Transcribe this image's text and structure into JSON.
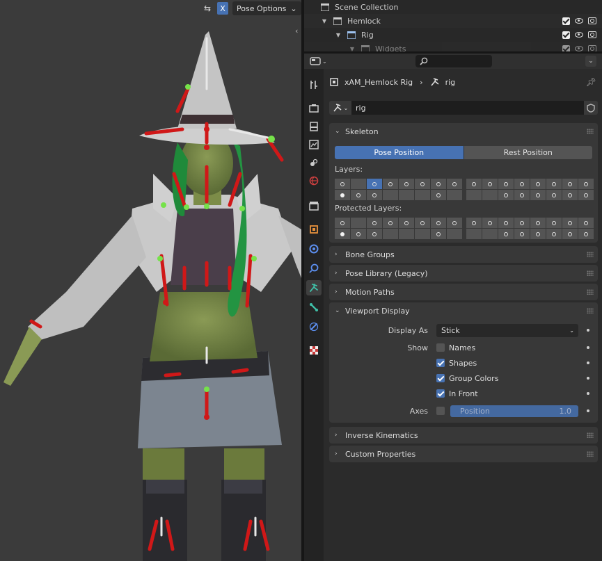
{
  "viewport": {
    "x_axis_label": "X",
    "pose_options_label": "Pose Options"
  },
  "outliner": {
    "rows": [
      {
        "label": "Scene Collection"
      },
      {
        "label": "Hemlock"
      },
      {
        "label": "Rig"
      },
      {
        "label": "Widgets"
      }
    ]
  },
  "properties": {
    "search_placeholder": "",
    "breadcrumb": {
      "object": "xAM_Hemlock Rig",
      "data": "rig"
    },
    "datablock_name": "rig",
    "tabs": [
      "tool",
      "render",
      "output",
      "view-layer",
      "scene",
      "world",
      "collection",
      "object",
      "modifiers",
      "particles",
      "physics",
      "object-data-armature",
      "bone",
      "bone-constraints",
      "texture"
    ],
    "active_tab": "object-data-armature",
    "skeleton": {
      "title": "Skeleton",
      "pose_position": "Pose Position",
      "rest_position": "Rest Position",
      "active_position": "Pose Position",
      "layers_label": "Layers:",
      "protected_layers_label": "Protected Layers:",
      "layers": {
        "left": [
          [
            "o",
            "",
            "sel",
            "o",
            "o",
            "o",
            "o",
            "o"
          ],
          [
            "full",
            "o",
            "o",
            "",
            "",
            "",
            "o",
            ""
          ]
        ],
        "right": [
          [
            "o",
            "o",
            "o",
            "o",
            "o",
            "o",
            "o",
            "o"
          ],
          [
            "",
            "",
            "o",
            "o",
            "o",
            "o",
            "o",
            "o"
          ]
        ]
      },
      "protected": {
        "left": [
          [
            "o",
            "",
            "o",
            "o",
            "o",
            "o",
            "o",
            "o"
          ],
          [
            "full",
            "o",
            "o",
            "",
            "",
            "",
            "o",
            ""
          ]
        ],
        "right": [
          [
            "o",
            "o",
            "o",
            "o",
            "o",
            "o",
            "o",
            "o"
          ],
          [
            "",
            "",
            "o",
            "o",
            "o",
            "o",
            "o",
            "o"
          ]
        ]
      }
    },
    "collapsed_panels_1": [
      "Bone Groups",
      "Pose Library (Legacy)",
      "Motion Paths"
    ],
    "viewport_display": {
      "title": "Viewport Display",
      "display_as_label": "Display As",
      "display_as_value": "Stick",
      "show_label": "Show",
      "options": [
        {
          "label": "Names",
          "checked": false
        },
        {
          "label": "Shapes",
          "checked": true
        },
        {
          "label": "Group Colors",
          "checked": true
        },
        {
          "label": "In Front",
          "checked": true
        }
      ],
      "axes_label": "Axes",
      "axes_checked": false,
      "axes_position_label": "Position",
      "axes_position_value": "1.0"
    },
    "collapsed_panels_2": [
      "Inverse Kinematics",
      "Custom Properties"
    ]
  }
}
